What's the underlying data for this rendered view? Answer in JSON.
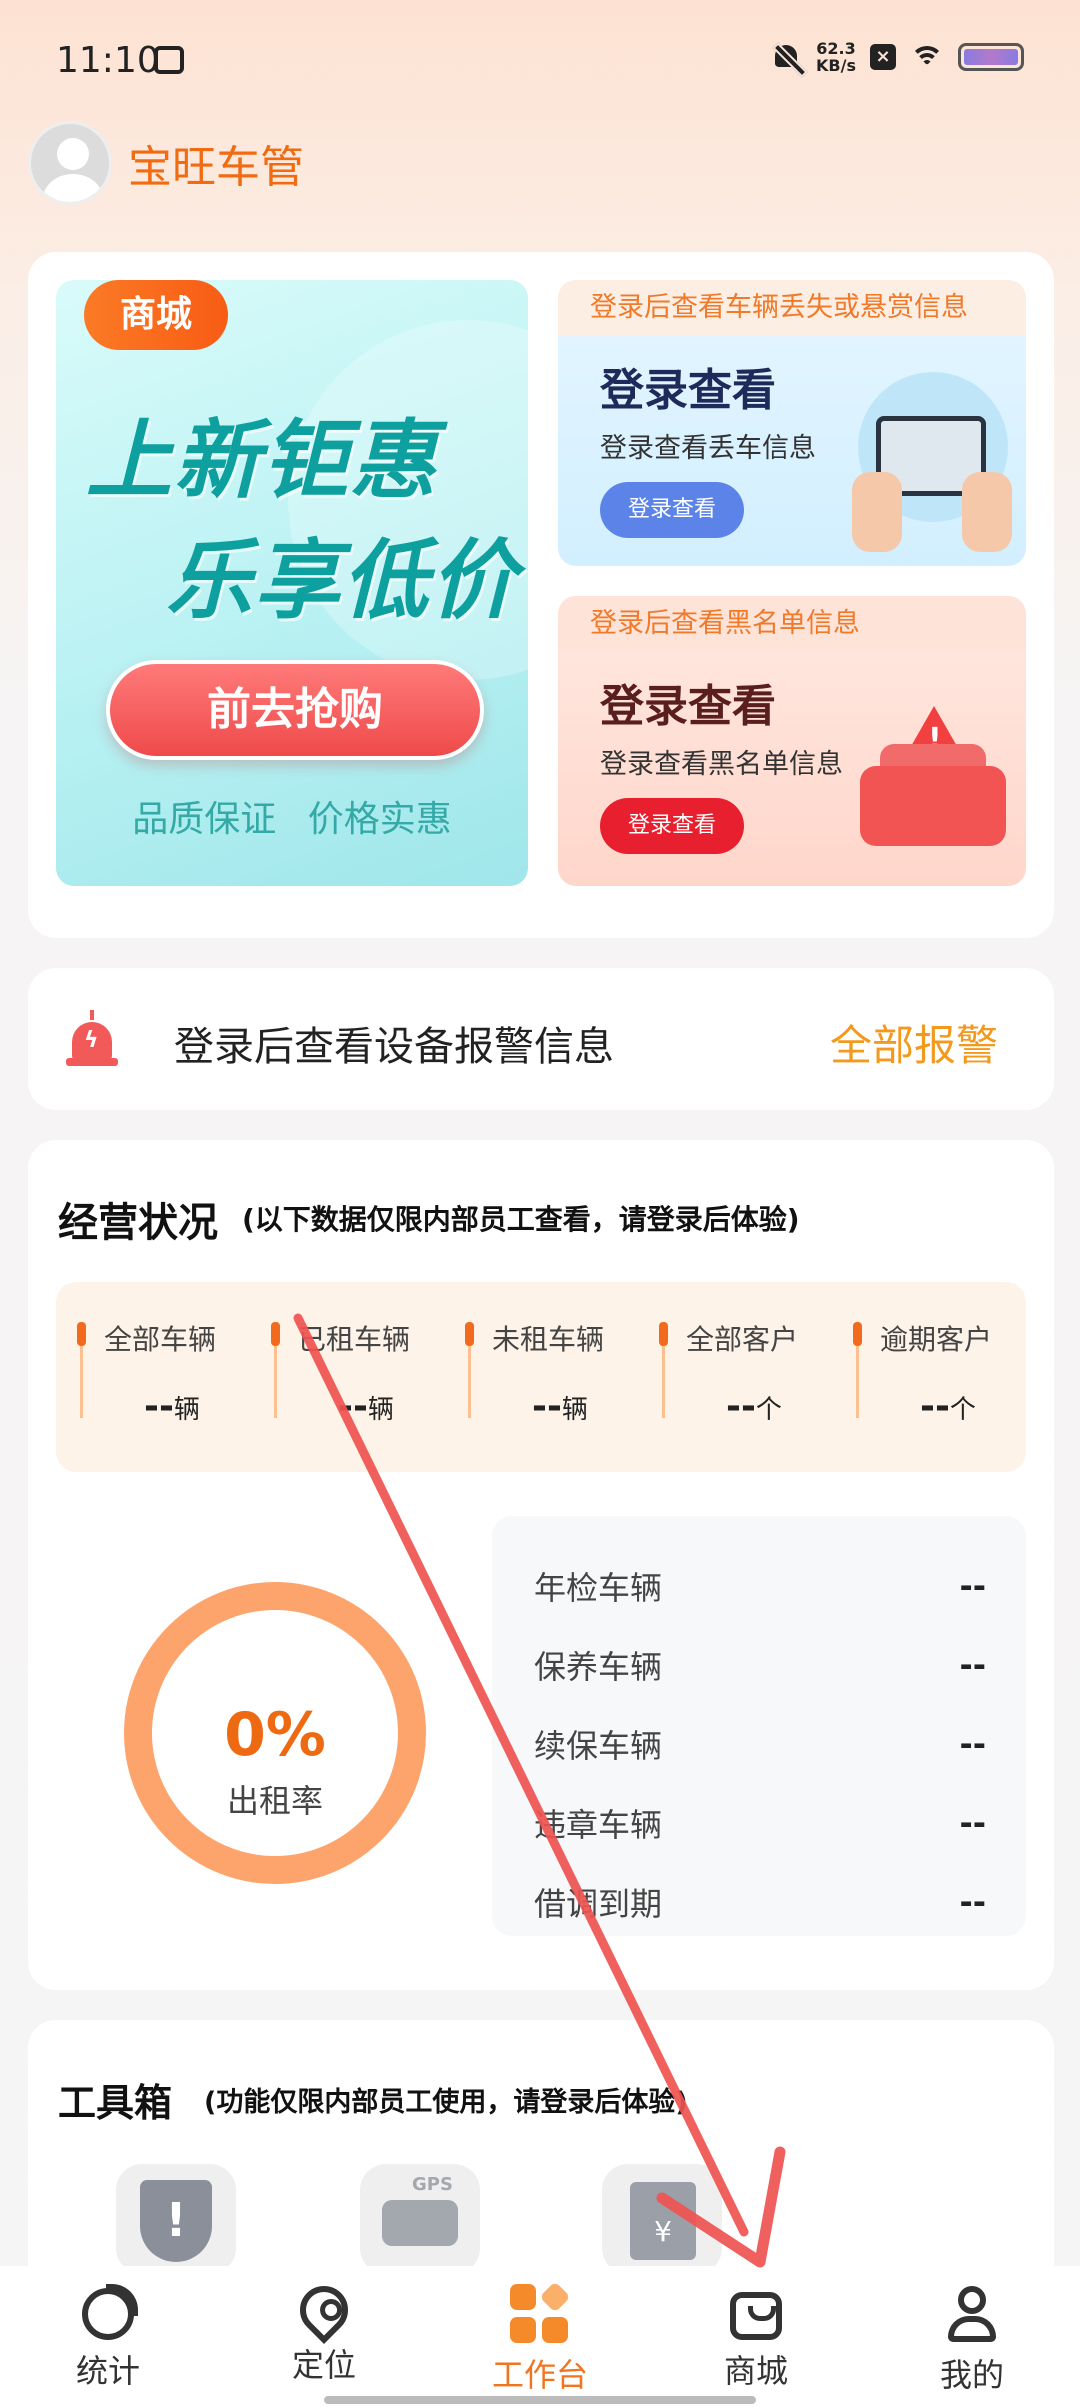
{
  "status_bar": {
    "time": "11:10",
    "net_speed_value": "62.3",
    "net_speed_unit": "KB/s",
    "icons": [
      "card-icon",
      "mute-icon",
      "close-box-icon",
      "wifi-icon",
      "battery-icon"
    ]
  },
  "header": {
    "app_title": "宝旺车管"
  },
  "banner": {
    "promo": {
      "badge": "商城",
      "line1": "上新钜惠",
      "line2": "乐享低价",
      "button": "前去抢购",
      "tagline": "品质保证 价格实惠"
    },
    "lost_car": {
      "top_text": "登录后查看车辆丢失或悬赏信息",
      "title": "登录查看",
      "subtitle": "登录查看丢车信息",
      "button": "登录查看"
    },
    "blacklist": {
      "top_text": "登录后查看黑名单信息",
      "title": "登录查看",
      "subtitle": "登录查看黑名单信息",
      "button": "登录查看"
    }
  },
  "alarm": {
    "text": "登录后查看设备报警信息",
    "link": "全部报警"
  },
  "business": {
    "title": "经营状况",
    "note": "(以下数据仅限内部员工查看，请登录后体验)",
    "stats": [
      {
        "label": "全部车辆",
        "value": "--",
        "unit": "辆"
      },
      {
        "label": "已租车辆",
        "value": "--",
        "unit": "辆"
      },
      {
        "label": "未租车辆",
        "value": "--",
        "unit": "辆"
      },
      {
        "label": "全部客户",
        "value": "--",
        "unit": "个"
      },
      {
        "label": "逾期客户",
        "value": "--",
        "unit": "个"
      }
    ],
    "rent_rate": {
      "value": "0%",
      "label": "出租率",
      "fraction": 0
    },
    "list": [
      {
        "name": "年检车辆",
        "value": "--"
      },
      {
        "name": "保养车辆",
        "value": "--"
      },
      {
        "name": "续保车辆",
        "value": "--"
      },
      {
        "name": "违章车辆",
        "value": "--"
      },
      {
        "name": "借调到期",
        "value": "--"
      }
    ]
  },
  "toolbox": {
    "title": "工具箱",
    "note": "(功能仅限内部员工使用，请登录后体验)",
    "tools": [
      {
        "icon": "shield-alert-icon"
      },
      {
        "icon": "gps-car-icon",
        "badge": "GPS"
      },
      {
        "icon": "bill-icon",
        "symbol": "¥"
      }
    ]
  },
  "bottom_nav": [
    {
      "label": "统计",
      "icon": "pie-chart-icon",
      "active": false
    },
    {
      "label": "定位",
      "icon": "location-pin-icon",
      "active": false
    },
    {
      "label": "工作台",
      "icon": "workbench-grid-icon",
      "active": true
    },
    {
      "label": "商城",
      "icon": "shopping-bag-icon",
      "active": false
    },
    {
      "label": "我的",
      "icon": "user-icon",
      "active": false
    }
  ],
  "colors": {
    "accent": "#f06b12",
    "annotation_arrow": "#ef5350"
  }
}
